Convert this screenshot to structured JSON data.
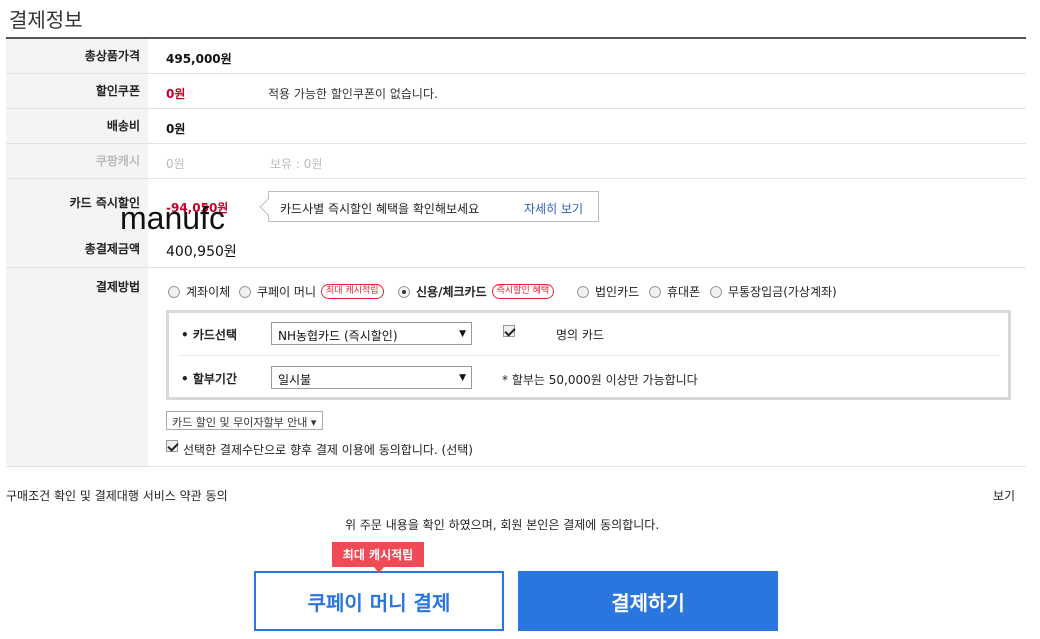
{
  "section_title": "결제정보",
  "rows": {
    "total_price": {
      "label": "총상품가격",
      "value": "495,000원"
    },
    "coupon": {
      "label": "할인쿠폰",
      "value": "0원",
      "note": "적용 가능한 할인쿠폰이 없습니다."
    },
    "shipping": {
      "label": "배송비",
      "value": "0원"
    },
    "cash": {
      "label": "쿠팡캐시",
      "value": "0원",
      "note": "보유 : 0원"
    },
    "card_discount": {
      "label": "카드 즉시할인",
      "value": "-94,050원"
    },
    "total_pay": {
      "label": "총결제금액",
      "value": "400,950원"
    },
    "method": {
      "label": "결제방법"
    }
  },
  "tooltip": {
    "text": "카드사별 즉시할인 혜택을 확인해보세요",
    "link": "자세히 보기"
  },
  "watermark": "manufc",
  "payment_methods": [
    {
      "label": "계좌이체",
      "selected": false
    },
    {
      "label": "쿠페이 머니",
      "badge": "최대 캐시적립",
      "selected": false
    },
    {
      "label": "신용/체크카드",
      "badge": "즉시할인 혜택",
      "selected": true
    },
    {
      "label": "법인카드",
      "selected": false
    },
    {
      "label": "휴대폰",
      "selected": false
    },
    {
      "label": "무통장입금(가상계좌)",
      "selected": false
    }
  ],
  "card_select": {
    "label": "• 카드선택",
    "value": "NH농협카드 (즉시할인)",
    "owner_text": "명의 카드"
  },
  "installment": {
    "label": "• 할부기간",
    "value": "일시불",
    "note": "* 할부는 50,000원 이상만 가능합니다"
  },
  "guide_button": "카드 할인 및 무이자할부 안내 ▾",
  "agree_future": "선택한 결제수단으로 향후 결제 이용에 동의합니다. (선택)",
  "terms": {
    "text": "구매조건 확인 및 결제대행 서비스 약관 동의",
    "link": "보기"
  },
  "confirm_text": "위 주문 내용을 확인 하였으며, 회원 본인은 결제에 동의합니다.",
  "promo_tag": "최대 캐시적립",
  "cashpay_button": "쿠페이 머니 결제",
  "pay_button": "결제하기",
  "colors": {
    "accent": "#2b75de",
    "discount_red": "#c4002a",
    "badge_red": "#f04a57"
  }
}
